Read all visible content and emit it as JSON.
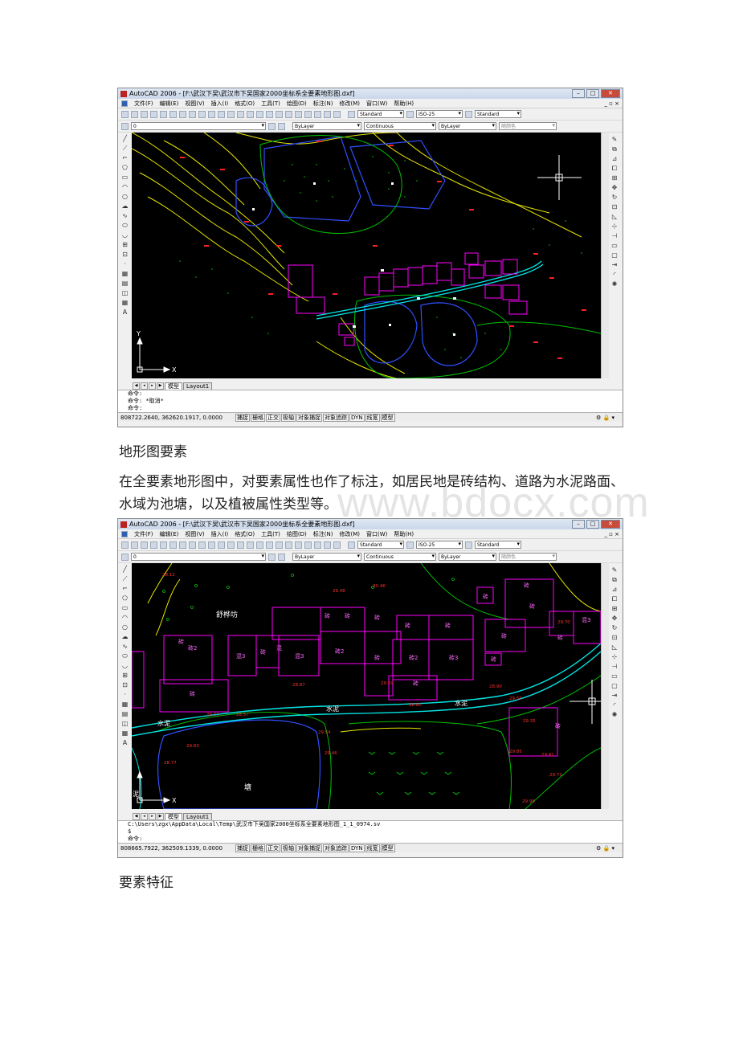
{
  "window1": {
    "title": "AutoCAD 2006 - [F:\\武汉下吴\\武汉市下吴国家2000坐标系全要素地形图.dxf]",
    "menu": [
      "文件(F)",
      "编辑(E)",
      "视图(V)",
      "插入(I)",
      "格式(O)",
      "工具(T)",
      "绘图(D)",
      "标注(N)",
      "修改(M)",
      "窗口(W)",
      "帮助(H)"
    ],
    "text_style": "Standard",
    "dim_style": "ISO-25",
    "table_style": "Standard",
    "layer": "0",
    "color": "ByLayer",
    "linetype": "Continuous",
    "lineweight": "ByLayer",
    "plotstyle": "随颜色",
    "tabs": [
      "模型",
      "Layout1"
    ],
    "cmd_lines": [
      "命令:",
      "命令: *取消*",
      "命令:"
    ],
    "coords": "808722.2640, 362620.1917, 0.0000",
    "status_buttons": [
      "捕捉",
      "栅格",
      "正交",
      "极轴",
      "对象捕捉",
      "对象追踪",
      "DYN",
      "线宽",
      "模型"
    ],
    "ucs_y": "Y",
    "ucs_x": "X"
  },
  "caption1": "地形图要素",
  "paragraph": "在全要素地形图中，对要素属性也作了标注，如居民地是砖结构、道路为水泥路面、水域为池塘，以及植被属性类型等。",
  "watermark": "www.bdocx.com",
  "window2": {
    "title": "AutoCAD 2006 - [F:\\武汉下吴\\武汉市下吴国家2000坐标系全要素地形图.dxf]",
    "cmd_lines": [
      "C:\\Users\\zgx\\AppData\\Local\\Temp\\武汉市下吴国家2000坐标系全要素地形图_1_1_0974.sv",
      "$",
      "命令:"
    ],
    "coords": "808665.7922, 362509.1339, 0.0000",
    "map_labels": {
      "place": "舒桦坊",
      "road1": "水泥",
      "road2": "水泥",
      "road3": "水泥",
      "pond": "塘",
      "brick": "砖",
      "brick_mixed": "混",
      "brick2": "砖2",
      "mixed3": "混3",
      "brick3": "砖3",
      "side": "泥"
    },
    "elevations": [
      "28.12",
      "30.46",
      "29.48",
      "28.87",
      "29.59",
      "28.80",
      "28.77",
      "29.83",
      "29.01",
      "28.57",
      "29.54",
      "29.46",
      "28.90",
      "29.57",
      "29.35",
      "29.85",
      "29.41",
      "29.73",
      "29.70",
      "29.98"
    ]
  },
  "caption2": "要素特征"
}
